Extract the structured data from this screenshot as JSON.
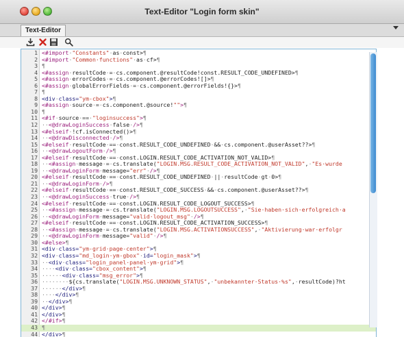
{
  "window": {
    "title": "Text-Editor \"Login form skin\""
  },
  "tabs": [
    {
      "label": "Text-Editor"
    }
  ],
  "toolbar": {
    "buttons": [
      {
        "icon": "import-icon"
      },
      {
        "icon": "delete-icon"
      },
      {
        "icon": "save-icon"
      },
      {
        "icon": "search-icon"
      }
    ]
  },
  "editor": {
    "active_line": 43,
    "lines": [
      [
        [
          "dir",
          "<#import"
        ],
        [
          "dot",
          "·"
        ],
        [
          "str",
          "\"Constants\""
        ],
        [
          "dot",
          "·"
        ],
        [
          "plain",
          "as"
        ],
        [
          "dot",
          "·"
        ],
        [
          "plain",
          "const>"
        ],
        [
          "pilcrow",
          "¶"
        ]
      ],
      [
        [
          "dir",
          "<#import"
        ],
        [
          "dot",
          "·"
        ],
        [
          "str",
          "\"Common·functions\""
        ],
        [
          "dot",
          "·"
        ],
        [
          "plain",
          "as"
        ],
        [
          "dot",
          "·"
        ],
        [
          "plain",
          "cf>"
        ],
        [
          "pilcrow",
          "¶"
        ]
      ],
      [
        [
          "pilcrow",
          "¶"
        ]
      ],
      [
        [
          "dir",
          "<#assign"
        ],
        [
          "dot",
          "·"
        ],
        [
          "plain",
          "resultCode"
        ],
        [
          "dot",
          "·"
        ],
        [
          "plain",
          "="
        ],
        [
          "dot",
          "·"
        ],
        [
          "plain",
          "cs.component.@resultCode!const.RESULT_CODE_UNDEFINED>"
        ],
        [
          "pilcrow",
          "¶"
        ]
      ],
      [
        [
          "dir",
          "<#assign"
        ],
        [
          "dot",
          "·"
        ],
        [
          "plain",
          "errorCodes"
        ],
        [
          "dot",
          "·"
        ],
        [
          "plain",
          "="
        ],
        [
          "dot",
          "·"
        ],
        [
          "plain",
          "cs.component.@errorCodes![]>"
        ],
        [
          "pilcrow",
          "¶"
        ]
      ],
      [
        [
          "dir",
          "<#assign"
        ],
        [
          "dot",
          "·"
        ],
        [
          "plain",
          "globalErrorFields"
        ],
        [
          "dot",
          "·"
        ],
        [
          "plain",
          "="
        ],
        [
          "dot",
          "·"
        ],
        [
          "plain",
          "cs.component.@errorFields!{}>"
        ],
        [
          "pilcrow",
          "¶"
        ]
      ],
      [
        [
          "pilcrow",
          "¶"
        ]
      ],
      [
        [
          "tag",
          "<div"
        ],
        [
          "dot",
          "·"
        ],
        [
          "attr",
          "class="
        ],
        [
          "str",
          "\"ym-cbox\""
        ],
        [
          "tag",
          ">"
        ],
        [
          "pilcrow",
          "¶"
        ]
      ],
      [
        [
          "dir",
          "<#assign"
        ],
        [
          "dot",
          "·"
        ],
        [
          "plain",
          "source"
        ],
        [
          "dot",
          "·"
        ],
        [
          "plain",
          "="
        ],
        [
          "dot",
          "·"
        ],
        [
          "plain",
          "cs.component.@source!"
        ],
        [
          "str",
          "\"\""
        ],
        [
          "dir",
          ">"
        ],
        [
          "pilcrow",
          "¶"
        ]
      ],
      [
        [
          "pilcrow",
          "¶"
        ]
      ],
      [
        [
          "dir",
          "<#if"
        ],
        [
          "dot",
          "·"
        ],
        [
          "plain",
          "source"
        ],
        [
          "dot",
          "·"
        ],
        [
          "plain",
          "=="
        ],
        [
          "dot",
          "·"
        ],
        [
          "str",
          "\"loginsuccess\""
        ],
        [
          "dir",
          ">"
        ],
        [
          "pilcrow",
          "¶"
        ]
      ],
      [
        [
          "dot",
          "··"
        ],
        [
          "dir",
          "<@drawLoginSuccess"
        ],
        [
          "dot",
          "·"
        ],
        [
          "plain",
          "false"
        ],
        [
          "dot",
          "·"
        ],
        [
          "dir",
          "/>"
        ],
        [
          "pilcrow",
          "¶"
        ]
      ],
      [
        [
          "dir",
          "<#elseif"
        ],
        [
          "dot",
          "·"
        ],
        [
          "plain",
          "!cf.isConnected()>"
        ],
        [
          "pilcrow",
          "¶"
        ]
      ],
      [
        [
          "dot",
          "··"
        ],
        [
          "dir",
          "<@drawDisconnected"
        ],
        [
          "dot",
          "·"
        ],
        [
          "dir",
          "/>"
        ],
        [
          "pilcrow",
          "¶"
        ]
      ],
      [
        [
          "dir",
          "<#elseif"
        ],
        [
          "dot",
          "·"
        ],
        [
          "plain",
          "resultCode"
        ],
        [
          "dot",
          "·"
        ],
        [
          "plain",
          "=="
        ],
        [
          "dot",
          "·"
        ],
        [
          "plain",
          "const.RESULT_CODE_UNDEFINED"
        ],
        [
          "dot",
          "·"
        ],
        [
          "plain",
          "&&"
        ],
        [
          "dot",
          "·"
        ],
        [
          "plain",
          "cs.component.@userAsset??>"
        ],
        [
          "pilcrow",
          "¶"
        ]
      ],
      [
        [
          "dot",
          "··"
        ],
        [
          "dir",
          "<@drawLogoutForm"
        ],
        [
          "dot",
          "·"
        ],
        [
          "dir",
          "/>"
        ],
        [
          "pilcrow",
          "¶"
        ]
      ],
      [
        [
          "dir",
          "<#elseif"
        ],
        [
          "dot",
          "·"
        ],
        [
          "plain",
          "resultCode"
        ],
        [
          "dot",
          "·"
        ],
        [
          "plain",
          "=="
        ],
        [
          "dot",
          "·"
        ],
        [
          "plain",
          "const.LOGIN.RESULT_CODE_ACTIVATION_NOT_VALID>"
        ],
        [
          "pilcrow",
          "¶"
        ]
      ],
      [
        [
          "dot",
          "··"
        ],
        [
          "dir",
          "<#assign"
        ],
        [
          "dot",
          "·"
        ],
        [
          "plain",
          "message"
        ],
        [
          "dot",
          "·"
        ],
        [
          "plain",
          "="
        ],
        [
          "dot",
          "·"
        ],
        [
          "plain",
          "cs.translate("
        ],
        [
          "str",
          "\"LOGIN.MSG.RESULT_CODE_ACTIVATION_NOT_VALID\""
        ],
        [
          "plain",
          ","
        ],
        [
          "dot",
          "·"
        ],
        [
          "str",
          "\"Es·wurde"
        ]
      ],
      [
        [
          "dot",
          "··"
        ],
        [
          "dir",
          "<@drawLoginForm"
        ],
        [
          "dot",
          "·"
        ],
        [
          "plain",
          "message="
        ],
        [
          "str",
          "\"err\""
        ],
        [
          "dot",
          "·"
        ],
        [
          "dir",
          "/>"
        ],
        [
          "pilcrow",
          "¶"
        ]
      ],
      [
        [
          "dir",
          "<#elseif"
        ],
        [
          "dot",
          "·"
        ],
        [
          "plain",
          "resultCode"
        ],
        [
          "dot",
          "·"
        ],
        [
          "plain",
          "=="
        ],
        [
          "dot",
          "·"
        ],
        [
          "plain",
          "const.RESULT_CODE_UNDEFINED"
        ],
        [
          "dot",
          "·"
        ],
        [
          "plain",
          "||"
        ],
        [
          "dot",
          "·"
        ],
        [
          "plain",
          "resultCode"
        ],
        [
          "dot",
          "·"
        ],
        [
          "plain",
          "gt"
        ],
        [
          "dot",
          "·"
        ],
        [
          "plain",
          "0>"
        ],
        [
          "pilcrow",
          "¶"
        ]
      ],
      [
        [
          "dot",
          "··"
        ],
        [
          "dir",
          "<@drawLoginForm"
        ],
        [
          "dot",
          "·"
        ],
        [
          "dir",
          "/>"
        ],
        [
          "pilcrow",
          "¶"
        ]
      ],
      [
        [
          "dir",
          "<#elseif"
        ],
        [
          "dot",
          "·"
        ],
        [
          "plain",
          "resultCode"
        ],
        [
          "dot",
          "·"
        ],
        [
          "plain",
          "=="
        ],
        [
          "dot",
          "·"
        ],
        [
          "plain",
          "const.RESULT_CODE_SUCCESS"
        ],
        [
          "dot",
          "·"
        ],
        [
          "plain",
          "&&"
        ],
        [
          "dot",
          "·"
        ],
        [
          "plain",
          "cs.component.@userAsset??>"
        ],
        [
          "pilcrow",
          "¶"
        ]
      ],
      [
        [
          "dot",
          "··"
        ],
        [
          "dir",
          "<@drawLoginSuccess"
        ],
        [
          "dot",
          "·"
        ],
        [
          "plain",
          "true"
        ],
        [
          "dot",
          "·"
        ],
        [
          "dir",
          "/>"
        ],
        [
          "pilcrow",
          "¶"
        ]
      ],
      [
        [
          "dir",
          "<#elseif"
        ],
        [
          "dot",
          "·"
        ],
        [
          "plain",
          "resultCode"
        ],
        [
          "dot",
          "·"
        ],
        [
          "plain",
          "=="
        ],
        [
          "dot",
          "·"
        ],
        [
          "plain",
          "const.LOGIN.RESULT_CODE_LOGOUT_SUCCESS>"
        ],
        [
          "pilcrow",
          "¶"
        ]
      ],
      [
        [
          "dot",
          "··"
        ],
        [
          "dir",
          "<#assign"
        ],
        [
          "dot",
          "·"
        ],
        [
          "plain",
          "message"
        ],
        [
          "dot",
          "·"
        ],
        [
          "plain",
          "="
        ],
        [
          "dot",
          "·"
        ],
        [
          "plain",
          "cs.translate("
        ],
        [
          "str",
          "\"LOGIN.MSG.LOGOUTSUCCESS\""
        ],
        [
          "plain",
          ","
        ],
        [
          "dot",
          "·"
        ],
        [
          "str",
          "\"Sie·haben·sich·erfolgreich·a"
        ]
      ],
      [
        [
          "dot",
          "··"
        ],
        [
          "dir",
          "<@drawLoginForm"
        ],
        [
          "dot",
          "·"
        ],
        [
          "plain",
          "message="
        ],
        [
          "str",
          "\"valid·logout_msg\""
        ],
        [
          "dot",
          "·"
        ],
        [
          "dir",
          "/>"
        ],
        [
          "pilcrow",
          "¶"
        ]
      ],
      [
        [
          "dir",
          "<#elseif"
        ],
        [
          "dot",
          "·"
        ],
        [
          "plain",
          "resultCode"
        ],
        [
          "dot",
          "·"
        ],
        [
          "plain",
          "=="
        ],
        [
          "dot",
          "·"
        ],
        [
          "plain",
          "const.LOGIN.RESULT_CODE_ACTIVATION_SUCCESS>"
        ],
        [
          "pilcrow",
          "¶"
        ]
      ],
      [
        [
          "dot",
          "··"
        ],
        [
          "dir",
          "<#assign"
        ],
        [
          "dot",
          "·"
        ],
        [
          "plain",
          "message"
        ],
        [
          "dot",
          "·"
        ],
        [
          "plain",
          "="
        ],
        [
          "dot",
          "·"
        ],
        [
          "plain",
          "cs.translate("
        ],
        [
          "str",
          "\"LOGIN.MSG.ACTIVATIONSUCCESS\""
        ],
        [
          "plain",
          ","
        ],
        [
          "dot",
          "·"
        ],
        [
          "str",
          "\"Aktivierung·war·erfolgr"
        ]
      ],
      [
        [
          "dot",
          "··"
        ],
        [
          "dir",
          "<@drawLoginForm"
        ],
        [
          "dot",
          "·"
        ],
        [
          "plain",
          "message="
        ],
        [
          "str",
          "\"valid\""
        ],
        [
          "dot",
          "·"
        ],
        [
          "dir",
          "/>"
        ],
        [
          "pilcrow",
          "¶"
        ]
      ],
      [
        [
          "dir",
          "<#else>"
        ],
        [
          "pilcrow",
          "¶"
        ]
      ],
      [
        [
          "tag",
          "<div"
        ],
        [
          "dot",
          "·"
        ],
        [
          "attr",
          "class="
        ],
        [
          "str",
          "\"ym-grid·page-center\""
        ],
        [
          "tag",
          ">"
        ],
        [
          "pilcrow",
          "¶"
        ]
      ],
      [
        [
          "tag",
          "<div"
        ],
        [
          "dot",
          "·"
        ],
        [
          "attr",
          "class="
        ],
        [
          "str",
          "\"md_login·ym-gbox\""
        ],
        [
          "dot",
          "·"
        ],
        [
          "attr",
          "id="
        ],
        [
          "str",
          "\"login_mask\""
        ],
        [
          "tag",
          ">"
        ],
        [
          "pilcrow",
          "¶"
        ]
      ],
      [
        [
          "dot",
          "··"
        ],
        [
          "tag",
          "<div"
        ],
        [
          "dot",
          "·"
        ],
        [
          "attr",
          "class="
        ],
        [
          "str",
          "\"login_panel·panel·ym-grid\""
        ],
        [
          "tag",
          ">"
        ],
        [
          "pilcrow",
          "¶"
        ]
      ],
      [
        [
          "dot",
          "····"
        ],
        [
          "tag",
          "<div"
        ],
        [
          "dot",
          "·"
        ],
        [
          "attr",
          "class="
        ],
        [
          "str",
          "\"cbox_content\""
        ],
        [
          "tag",
          ">"
        ],
        [
          "pilcrow",
          "¶"
        ]
      ],
      [
        [
          "dot",
          "······"
        ],
        [
          "tag",
          "<div"
        ],
        [
          "dot",
          "·"
        ],
        [
          "attr",
          "class="
        ],
        [
          "str",
          "\"msg_error\""
        ],
        [
          "tag",
          ">"
        ],
        [
          "pilcrow",
          "¶"
        ]
      ],
      [
        [
          "dot",
          "········"
        ],
        [
          "plain",
          "${cs.translate("
        ],
        [
          "str",
          "\"LOGIN.MSG.UNKNOWN_STATUS\""
        ],
        [
          "plain",
          ","
        ],
        [
          "dot",
          "·"
        ],
        [
          "str",
          "\"unbekannter·Status·%s\""
        ],
        [
          "plain",
          ","
        ],
        [
          "dot",
          "·"
        ],
        [
          "plain",
          "resultCode)?ht"
        ]
      ],
      [
        [
          "dot",
          "······"
        ],
        [
          "tag",
          "</div>"
        ],
        [
          "pilcrow",
          "¶"
        ]
      ],
      [
        [
          "dot",
          "····"
        ],
        [
          "tag",
          "</div>"
        ],
        [
          "pilcrow",
          "¶"
        ]
      ],
      [
        [
          "dot",
          "··"
        ],
        [
          "tag",
          "</div>"
        ],
        [
          "pilcrow",
          "¶"
        ]
      ],
      [
        [
          "tag",
          "</div>"
        ],
        [
          "pilcrow",
          "¶"
        ]
      ],
      [
        [
          "tag",
          "</div>"
        ],
        [
          "pilcrow",
          "¶"
        ]
      ],
      [
        [
          "dir",
          "</#if>"
        ],
        [
          "pilcrow",
          "¶"
        ]
      ],
      [
        [
          "pilcrow",
          "¶"
        ]
      ],
      [
        [
          "tag",
          "</div>"
        ],
        [
          "pilcrow",
          "¶"
        ]
      ],
      [
        [
          "pilcrow",
          "¶"
        ]
      ]
    ]
  },
  "colors": {
    "tag": "#1a1a7a",
    "directive": "#9a1f7c",
    "string": "#c0392b",
    "active_line": "#ddf0c8",
    "scroll_thumb": "#3d8ad0"
  }
}
